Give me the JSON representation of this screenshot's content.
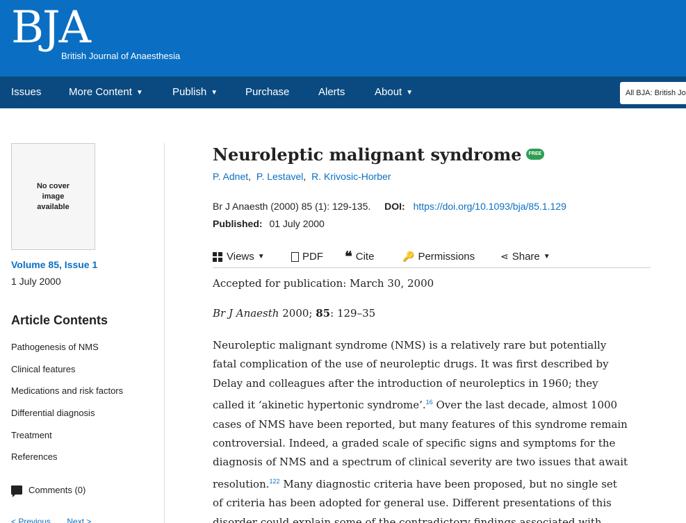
{
  "header": {
    "logo": "BJA",
    "journal_name": "British Journal of Anaesthesia"
  },
  "nav": {
    "items": [
      {
        "label": "Issues",
        "dropdown": false
      },
      {
        "label": "More Content",
        "dropdown": true
      },
      {
        "label": "Publish",
        "dropdown": true
      },
      {
        "label": "Purchase",
        "dropdown": false
      },
      {
        "label": "Alerts",
        "dropdown": false
      },
      {
        "label": "About",
        "dropdown": true
      }
    ],
    "search_scope": "All BJA: British Jo"
  },
  "sidebar": {
    "cover_text": "No cover image available",
    "volume": "Volume 85, Issue 1",
    "issue_date": "1 July 2000",
    "article_contents_title": "Article Contents",
    "toc": [
      "Pathogenesis of NMS",
      "Clinical features",
      "Medications and risk factors",
      "Differential diagnosis",
      "Treatment",
      "References"
    ],
    "comments": "Comments (0)",
    "previous": "< Previous",
    "next": "Next >"
  },
  "article": {
    "title": "Neuroleptic malignant syndrome",
    "free_badge": "FREE",
    "authors": [
      "P. Adnet",
      "P. Lestavel",
      "R. Krivosic-Horber"
    ],
    "citation": "Br J Anaesth (2000) 85 (1): 129-135.",
    "doi_label": "DOI:",
    "doi": "https://doi.org/10.1093/bja/85.1.129",
    "published_label": "Published:",
    "published_date": "01 July 2000",
    "toolbar": {
      "views": "Views",
      "pdf": "PDF",
      "cite": "Cite",
      "permissions": "Permissions",
      "share": "Share"
    },
    "accepted": "Accepted for publication: March 30, 2000",
    "ref_journal": "Br J Anaesth",
    "ref_year": "2000;",
    "ref_volume": "85",
    "ref_pages": ": 129–35",
    "body_lines": [
      "Neuroleptic malignant syndrome (NMS) is a relatively rare but potentially",
      "fatal complication of the use of neuroleptic drugs. It was first described by",
      "Delay and colleagues after the introduction of neuroleptics in 1960; they",
      "called it ‘akinetic hypertonic syndrome’.",
      " Over the last decade, almost 1000",
      "cases of NMS have been reported, but many features of this syndrome remain",
      "controversial. Indeed, a graded scale of specific signs and symptoms for the",
      "diagnosis of NMS and a spectrum of clinical severity are two issues that await",
      "resolution.",
      " Many diagnostic criteria have been proposed, but no single set",
      "of criteria has been adopted for general use. Different presentations of this",
      "disorder could explain some of the contradictory findings associated with"
    ],
    "ref_sup_1": "16",
    "ref_sup_2": "122"
  },
  "colors": {
    "header": "#0a6fc2",
    "nav": "#0b4a80",
    "link": "#0a6fc2",
    "badge": "#2e9e53"
  }
}
